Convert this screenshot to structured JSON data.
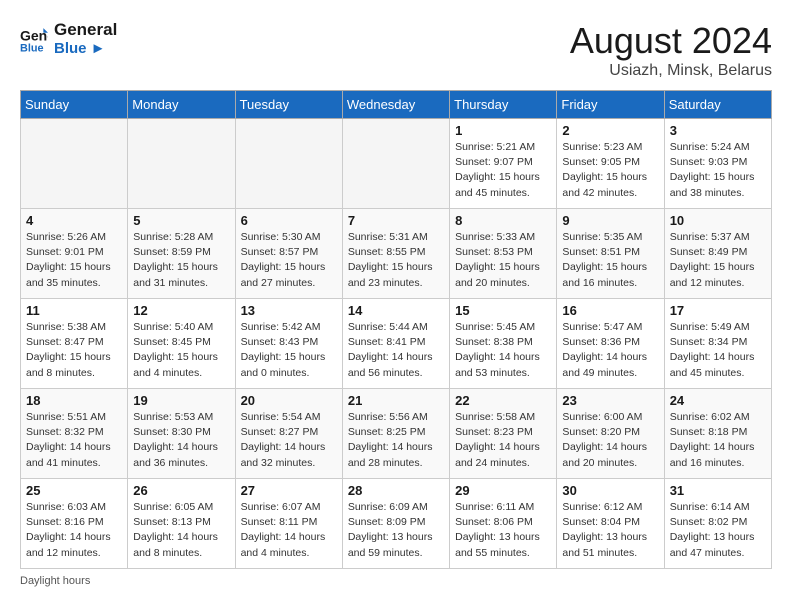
{
  "header": {
    "logo_line1": "General",
    "logo_line2": "Blue",
    "title": "August 2024",
    "subtitle": "Usiazh, Minsk, Belarus"
  },
  "weekdays": [
    "Sunday",
    "Monday",
    "Tuesday",
    "Wednesday",
    "Thursday",
    "Friday",
    "Saturday"
  ],
  "weeks": [
    [
      {
        "day": "",
        "info": ""
      },
      {
        "day": "",
        "info": ""
      },
      {
        "day": "",
        "info": ""
      },
      {
        "day": "",
        "info": ""
      },
      {
        "day": "1",
        "info": "Sunrise: 5:21 AM\nSunset: 9:07 PM\nDaylight: 15 hours\nand 45 minutes."
      },
      {
        "day": "2",
        "info": "Sunrise: 5:23 AM\nSunset: 9:05 PM\nDaylight: 15 hours\nand 42 minutes."
      },
      {
        "day": "3",
        "info": "Sunrise: 5:24 AM\nSunset: 9:03 PM\nDaylight: 15 hours\nand 38 minutes."
      }
    ],
    [
      {
        "day": "4",
        "info": "Sunrise: 5:26 AM\nSunset: 9:01 PM\nDaylight: 15 hours\nand 35 minutes."
      },
      {
        "day": "5",
        "info": "Sunrise: 5:28 AM\nSunset: 8:59 PM\nDaylight: 15 hours\nand 31 minutes."
      },
      {
        "day": "6",
        "info": "Sunrise: 5:30 AM\nSunset: 8:57 PM\nDaylight: 15 hours\nand 27 minutes."
      },
      {
        "day": "7",
        "info": "Sunrise: 5:31 AM\nSunset: 8:55 PM\nDaylight: 15 hours\nand 23 minutes."
      },
      {
        "day": "8",
        "info": "Sunrise: 5:33 AM\nSunset: 8:53 PM\nDaylight: 15 hours\nand 20 minutes."
      },
      {
        "day": "9",
        "info": "Sunrise: 5:35 AM\nSunset: 8:51 PM\nDaylight: 15 hours\nand 16 minutes."
      },
      {
        "day": "10",
        "info": "Sunrise: 5:37 AM\nSunset: 8:49 PM\nDaylight: 15 hours\nand 12 minutes."
      }
    ],
    [
      {
        "day": "11",
        "info": "Sunrise: 5:38 AM\nSunset: 8:47 PM\nDaylight: 15 hours\nand 8 minutes."
      },
      {
        "day": "12",
        "info": "Sunrise: 5:40 AM\nSunset: 8:45 PM\nDaylight: 15 hours\nand 4 minutes."
      },
      {
        "day": "13",
        "info": "Sunrise: 5:42 AM\nSunset: 8:43 PM\nDaylight: 15 hours\nand 0 minutes."
      },
      {
        "day": "14",
        "info": "Sunrise: 5:44 AM\nSunset: 8:41 PM\nDaylight: 14 hours\nand 56 minutes."
      },
      {
        "day": "15",
        "info": "Sunrise: 5:45 AM\nSunset: 8:38 PM\nDaylight: 14 hours\nand 53 minutes."
      },
      {
        "day": "16",
        "info": "Sunrise: 5:47 AM\nSunset: 8:36 PM\nDaylight: 14 hours\nand 49 minutes."
      },
      {
        "day": "17",
        "info": "Sunrise: 5:49 AM\nSunset: 8:34 PM\nDaylight: 14 hours\nand 45 minutes."
      }
    ],
    [
      {
        "day": "18",
        "info": "Sunrise: 5:51 AM\nSunset: 8:32 PM\nDaylight: 14 hours\nand 41 minutes."
      },
      {
        "day": "19",
        "info": "Sunrise: 5:53 AM\nSunset: 8:30 PM\nDaylight: 14 hours\nand 36 minutes."
      },
      {
        "day": "20",
        "info": "Sunrise: 5:54 AM\nSunset: 8:27 PM\nDaylight: 14 hours\nand 32 minutes."
      },
      {
        "day": "21",
        "info": "Sunrise: 5:56 AM\nSunset: 8:25 PM\nDaylight: 14 hours\nand 28 minutes."
      },
      {
        "day": "22",
        "info": "Sunrise: 5:58 AM\nSunset: 8:23 PM\nDaylight: 14 hours\nand 24 minutes."
      },
      {
        "day": "23",
        "info": "Sunrise: 6:00 AM\nSunset: 8:20 PM\nDaylight: 14 hours\nand 20 minutes."
      },
      {
        "day": "24",
        "info": "Sunrise: 6:02 AM\nSunset: 8:18 PM\nDaylight: 14 hours\nand 16 minutes."
      }
    ],
    [
      {
        "day": "25",
        "info": "Sunrise: 6:03 AM\nSunset: 8:16 PM\nDaylight: 14 hours\nand 12 minutes."
      },
      {
        "day": "26",
        "info": "Sunrise: 6:05 AM\nSunset: 8:13 PM\nDaylight: 14 hours\nand 8 minutes."
      },
      {
        "day": "27",
        "info": "Sunrise: 6:07 AM\nSunset: 8:11 PM\nDaylight: 14 hours\nand 4 minutes."
      },
      {
        "day": "28",
        "info": "Sunrise: 6:09 AM\nSunset: 8:09 PM\nDaylight: 13 hours\nand 59 minutes."
      },
      {
        "day": "29",
        "info": "Sunrise: 6:11 AM\nSunset: 8:06 PM\nDaylight: 13 hours\nand 55 minutes."
      },
      {
        "day": "30",
        "info": "Sunrise: 6:12 AM\nSunset: 8:04 PM\nDaylight: 13 hours\nand 51 minutes."
      },
      {
        "day": "31",
        "info": "Sunrise: 6:14 AM\nSunset: 8:02 PM\nDaylight: 13 hours\nand 47 minutes."
      }
    ]
  ],
  "footer": {
    "daylight_label": "Daylight hours"
  }
}
